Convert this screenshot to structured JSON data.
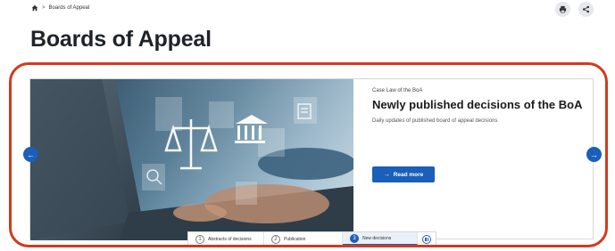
{
  "breadcrumb": {
    "icon": "home-icon",
    "separator": ">",
    "current": "Boards of Appeal"
  },
  "actions": {
    "print_icon": "print-icon",
    "share_icon": "share-icon"
  },
  "page": {
    "title": "Boards of Appeal"
  },
  "carousel": {
    "kicker": "Case Law of the BoA",
    "title": "Newly published decisions of the BoA",
    "description": "Daily updates of published board of appeal decisions",
    "cta_arrow": "→",
    "cta_label": "Read more",
    "prev_arrow": "←",
    "next_arrow": "→",
    "image": "laptop-legal-icons-photo",
    "tabs": [
      {
        "num": "1",
        "label": "Abstracts of decisions",
        "active": false
      },
      {
        "num": "2",
        "label": "Publication",
        "active": false
      },
      {
        "num": "3",
        "label": "New decisions",
        "active": true
      }
    ],
    "pause_icon": "pause-icon"
  },
  "colors": {
    "accent": "#1a5fb8",
    "highlight_frame": "#d23a1e",
    "title": "#1f2328"
  }
}
